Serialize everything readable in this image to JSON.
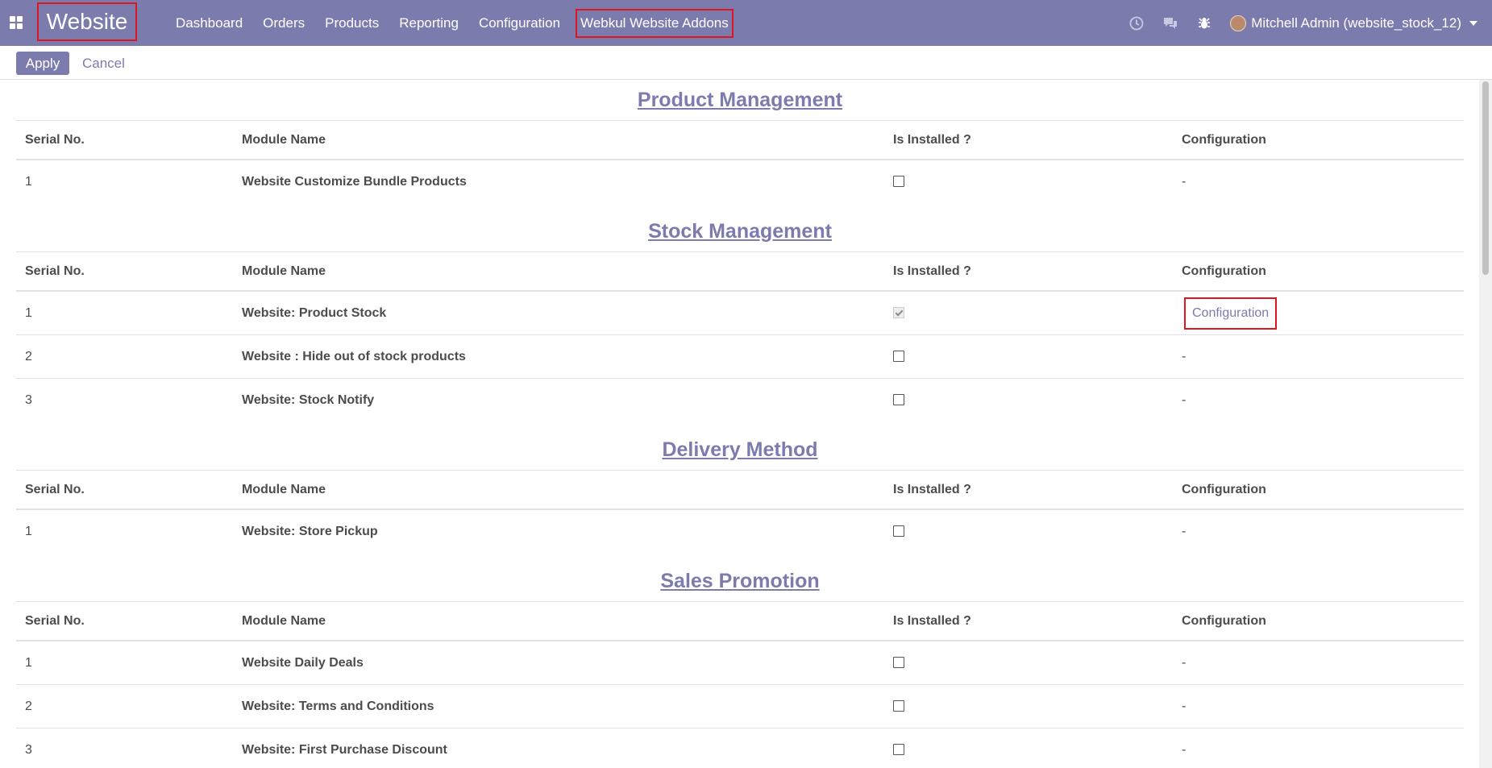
{
  "navbar": {
    "apps_icon": "apps-grid-icon",
    "brand": "Website",
    "menu": [
      "Dashboard",
      "Orders",
      "Products",
      "Reporting",
      "Configuration",
      "Webkul Website Addons"
    ],
    "systray_icons": [
      "clock-icon",
      "chat-icon",
      "bug-icon"
    ],
    "user_name": "Mitchell Admin (website_stock_12)",
    "accent_color": "#7c7bad",
    "highlight_color": "#e0151f"
  },
  "control_panel": {
    "apply_label": "Apply",
    "cancel_label": "Cancel"
  },
  "columns": {
    "serial": "Serial No.",
    "module": "Module Name",
    "installed": "Is Installed ?",
    "configuration": "Configuration"
  },
  "sections": [
    {
      "title": "Product Management",
      "rows": [
        {
          "serial": "1",
          "name": "Website Customize Bundle Products",
          "installed": false,
          "configuration": "-"
        }
      ]
    },
    {
      "title": "Stock Management",
      "rows": [
        {
          "serial": "1",
          "name": "Website: Product Stock",
          "installed": true,
          "configuration": "Configuration"
        },
        {
          "serial": "2",
          "name": "Website : Hide out of stock products",
          "installed": false,
          "configuration": "-"
        },
        {
          "serial": "3",
          "name": "Website: Stock Notify",
          "installed": false,
          "configuration": "-"
        }
      ]
    },
    {
      "title": "Delivery Method",
      "rows": [
        {
          "serial": "1",
          "name": "Website: Store Pickup",
          "installed": false,
          "configuration": "-"
        }
      ]
    },
    {
      "title": "Sales Promotion",
      "rows": [
        {
          "serial": "1",
          "name": "Website Daily Deals",
          "installed": false,
          "configuration": "-"
        },
        {
          "serial": "2",
          "name": "Website: Terms and Conditions",
          "installed": false,
          "configuration": "-"
        },
        {
          "serial": "3",
          "name": "Website: First Purchase Discount",
          "installed": false,
          "configuration": "-"
        }
      ]
    }
  ]
}
